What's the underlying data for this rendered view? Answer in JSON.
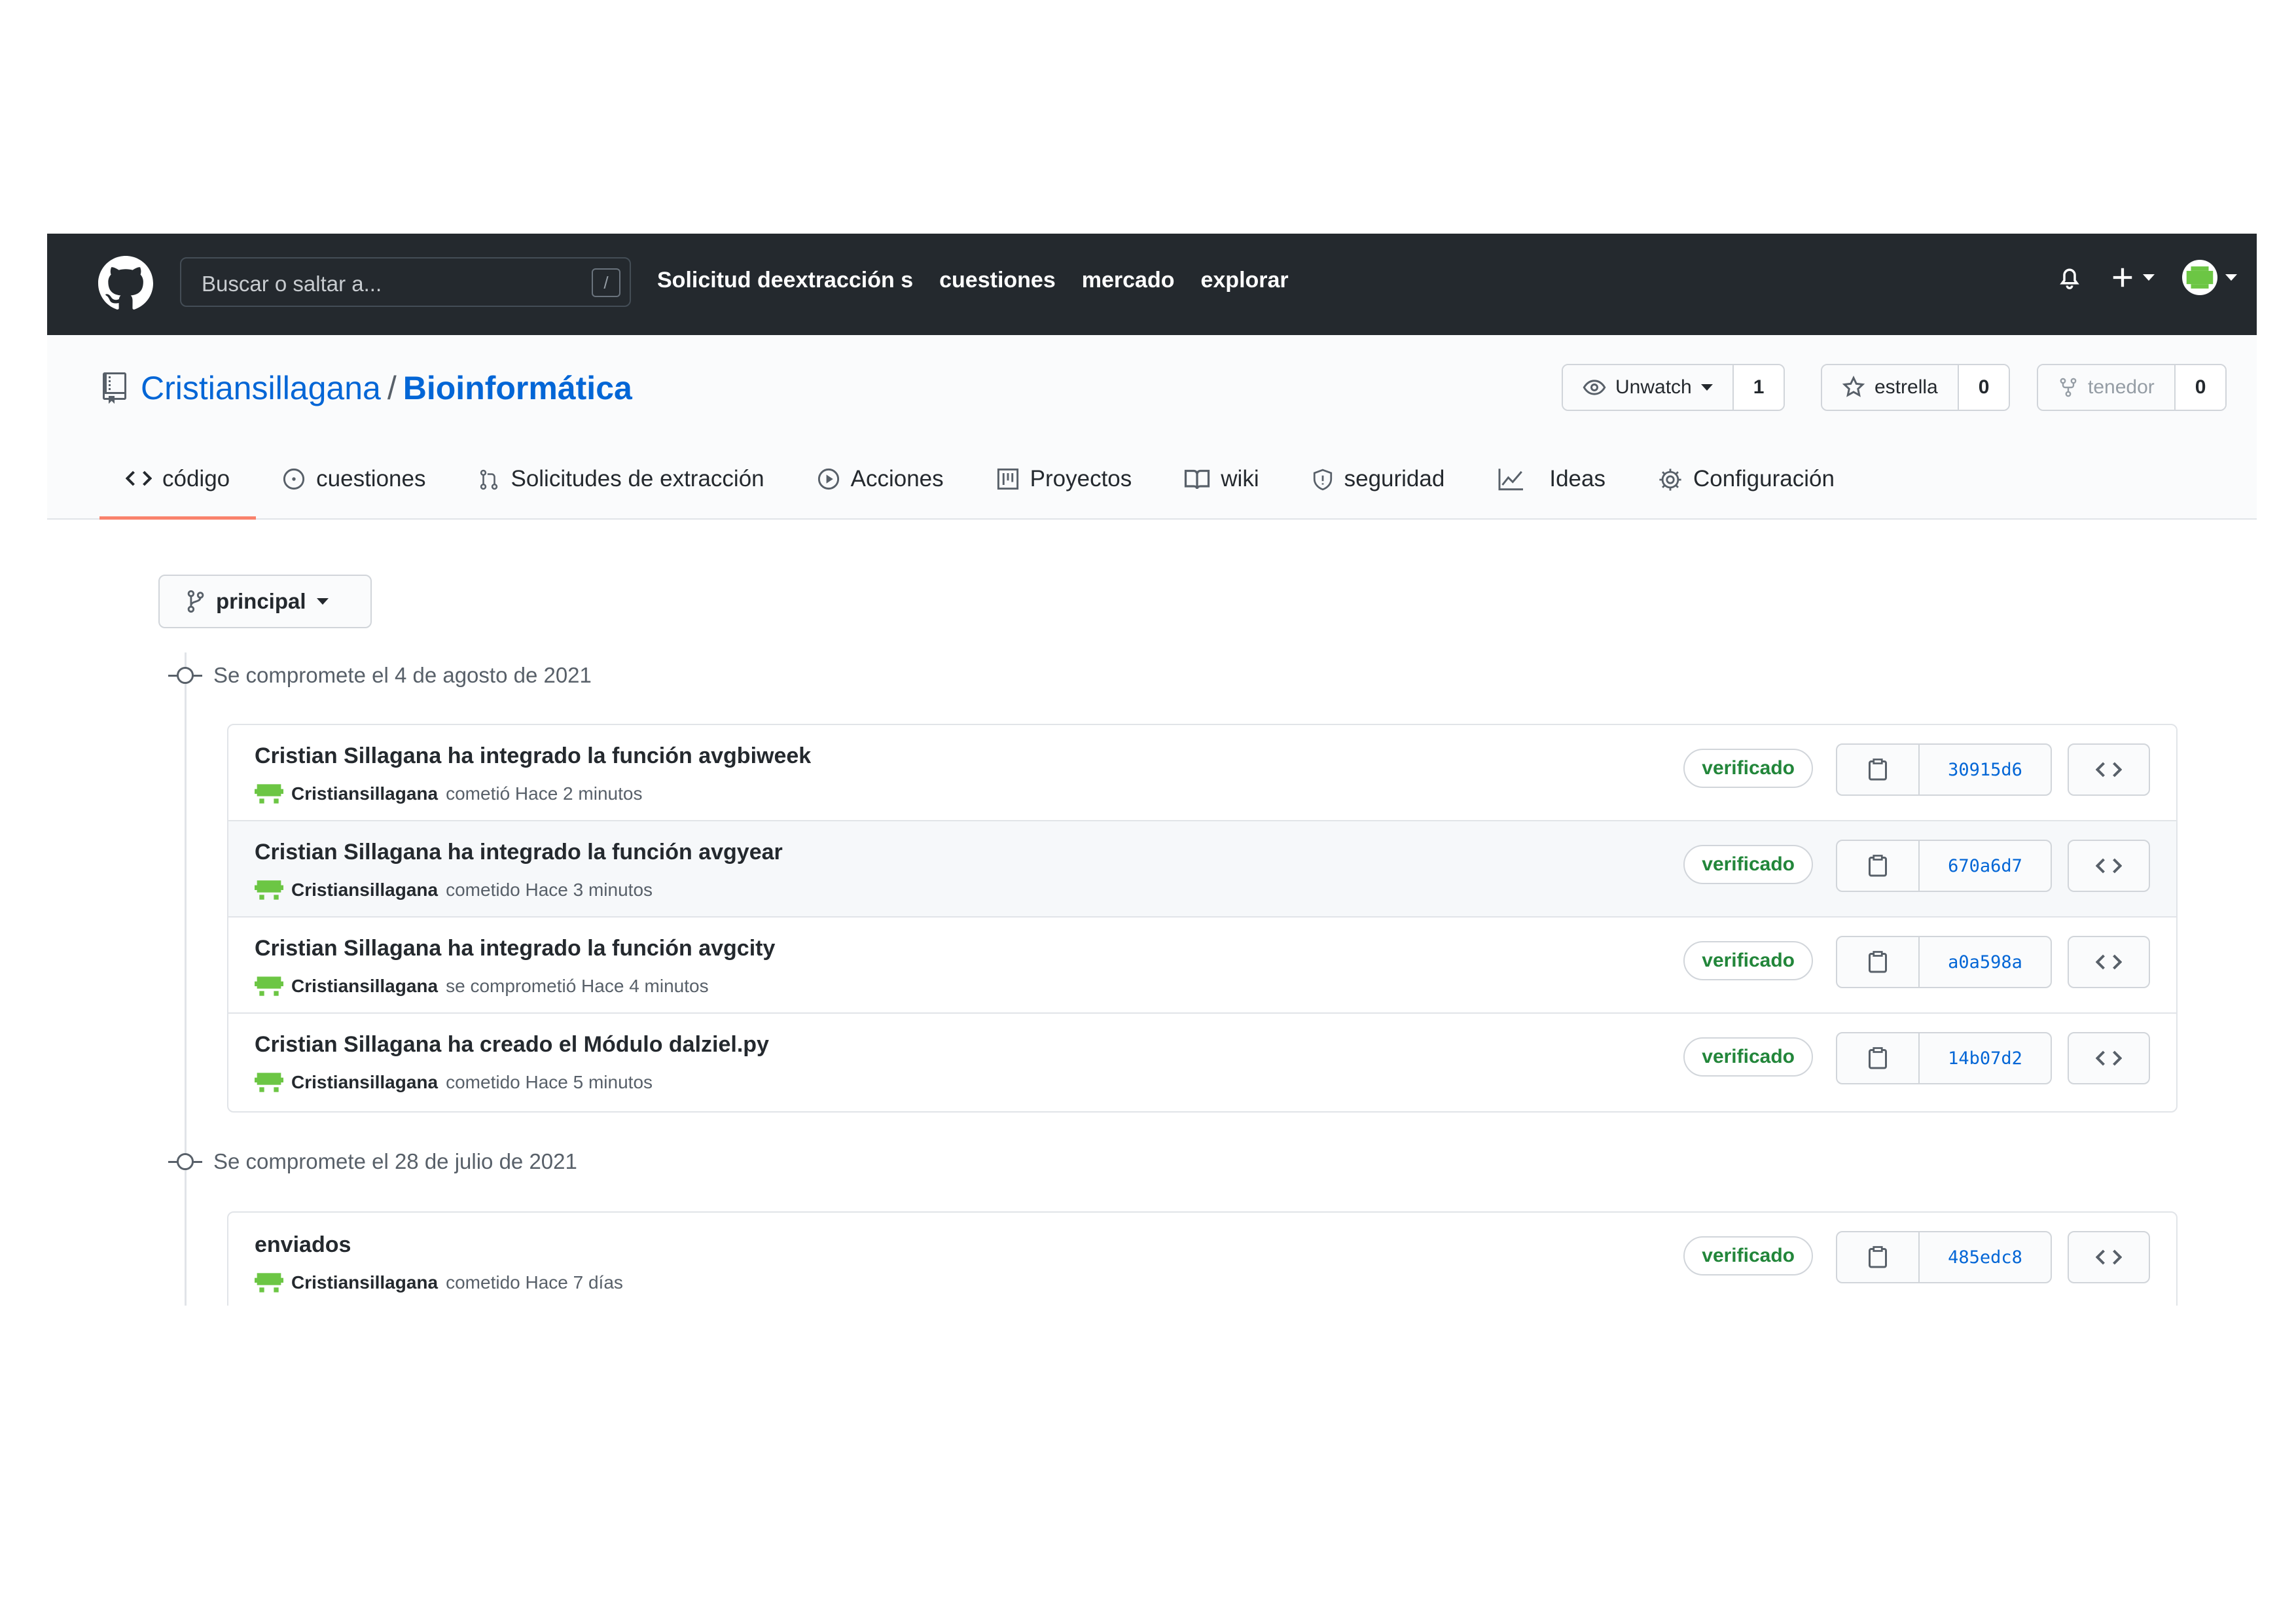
{
  "topbar": {
    "search_placeholder": "Buscar o saltar a...",
    "search_shortcut": "/",
    "nav": [
      "Solicitud deextracción s",
      "cuestiones",
      "mercado",
      "explorar"
    ]
  },
  "repo": {
    "owner": "Cristiansillagana",
    "separator": "/",
    "name": "Bioinformática",
    "watch_label": "Unwatch",
    "watch_count": "1",
    "star_label": "estrella",
    "star_count": "0",
    "fork_label": "tenedor",
    "fork_count": "0"
  },
  "tabs": [
    {
      "label": "código",
      "icon": "code-icon",
      "selected": true
    },
    {
      "label": "cuestiones",
      "icon": "issue-icon"
    },
    {
      "label": "Solicitudes de extracción",
      "icon": "pull-request-icon"
    },
    {
      "label": "Acciones",
      "icon": "play-icon"
    },
    {
      "label": "Proyectos",
      "icon": "project-icon"
    },
    {
      "label": "wiki",
      "icon": "book-icon"
    },
    {
      "label": "seguridad",
      "icon": "shield-icon"
    },
    {
      "label": "Ideas",
      "icon": "graph-icon"
    },
    {
      "label": "Configuración",
      "icon": "gear-icon"
    }
  ],
  "branch": {
    "label": "principal"
  },
  "days": [
    {
      "header": "Se compromete el 4 de agosto de 2021",
      "commits": [
        {
          "title": "Cristian Sillagana ha integrado la función avgbiweek",
          "author": "Cristiansillagana",
          "action": "cometió Hace 2 minutos",
          "badge": "verificado",
          "sha": "30915d6"
        },
        {
          "title": "Cristian Sillagana ha integrado la función avgyear",
          "author": "Cristiansillagana",
          "action": "cometido Hace 3 minutos",
          "badge": "verificado",
          "sha": "670a6d7"
        },
        {
          "title": "Cristian Sillagana ha integrado la función avgcity",
          "author": "Cristiansillagana",
          "action": "se comprometió Hace 4 minutos",
          "badge": "verificado",
          "sha": "a0a598a"
        },
        {
          "title": "Cristian Sillagana ha creado el Módulo dalziel.py",
          "author": "Cristiansillagana",
          "action": "cometido Hace 5 minutos",
          "badge": "verificado",
          "sha": "14b07d2"
        }
      ]
    },
    {
      "header": "Se compromete el 28 de julio de 2021",
      "commits": [
        {
          "title": "enviados",
          "author": "Cristiansillagana",
          "action": "cometido Hace 7 días",
          "badge": "verificado",
          "sha": "485edc8"
        }
      ]
    }
  ],
  "colors": {
    "topbar": "#24292e",
    "link": "#0366d6",
    "verified": "#22863a",
    "tab_underline": "#f9826c",
    "avatar": "#6cc644"
  }
}
